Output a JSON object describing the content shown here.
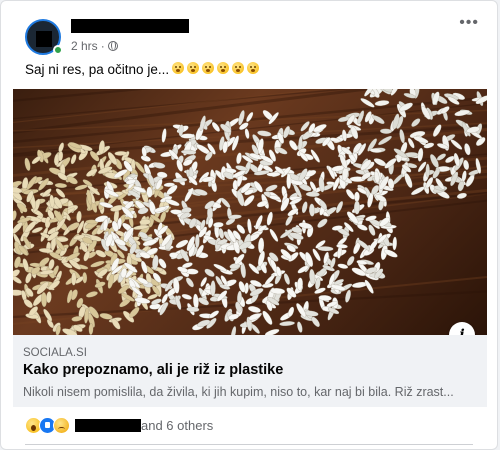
{
  "post": {
    "time": "2 hrs",
    "separator": "·",
    "text": "Saj ni res, pa očitno je...",
    "emoji_count": 6,
    "emoji_icon": "hushed-face-emoji",
    "more_glyph": "•••"
  },
  "link": {
    "domain": "SOCIALA.SI",
    "title": "Kako prepoznamo, ali je riž iz plastike",
    "description": "Nikoli nisem pomislila, da živila, ki jih kupim, niso to, kar naj bi bila. Riž zrast...",
    "info_glyph": "i",
    "image_subject": "rice grains on wooden table"
  },
  "reactions": {
    "icons": [
      "wow-reaction-icon",
      "like-reaction-icon",
      "sad-reaction-icon"
    ],
    "others_text": "and 6 others"
  },
  "colors": {
    "accent": "#1877f2",
    "online": "#31a24c",
    "muted_text": "#65676b",
    "body_text": "#050505",
    "preview_bg": "#f0f2f5"
  }
}
